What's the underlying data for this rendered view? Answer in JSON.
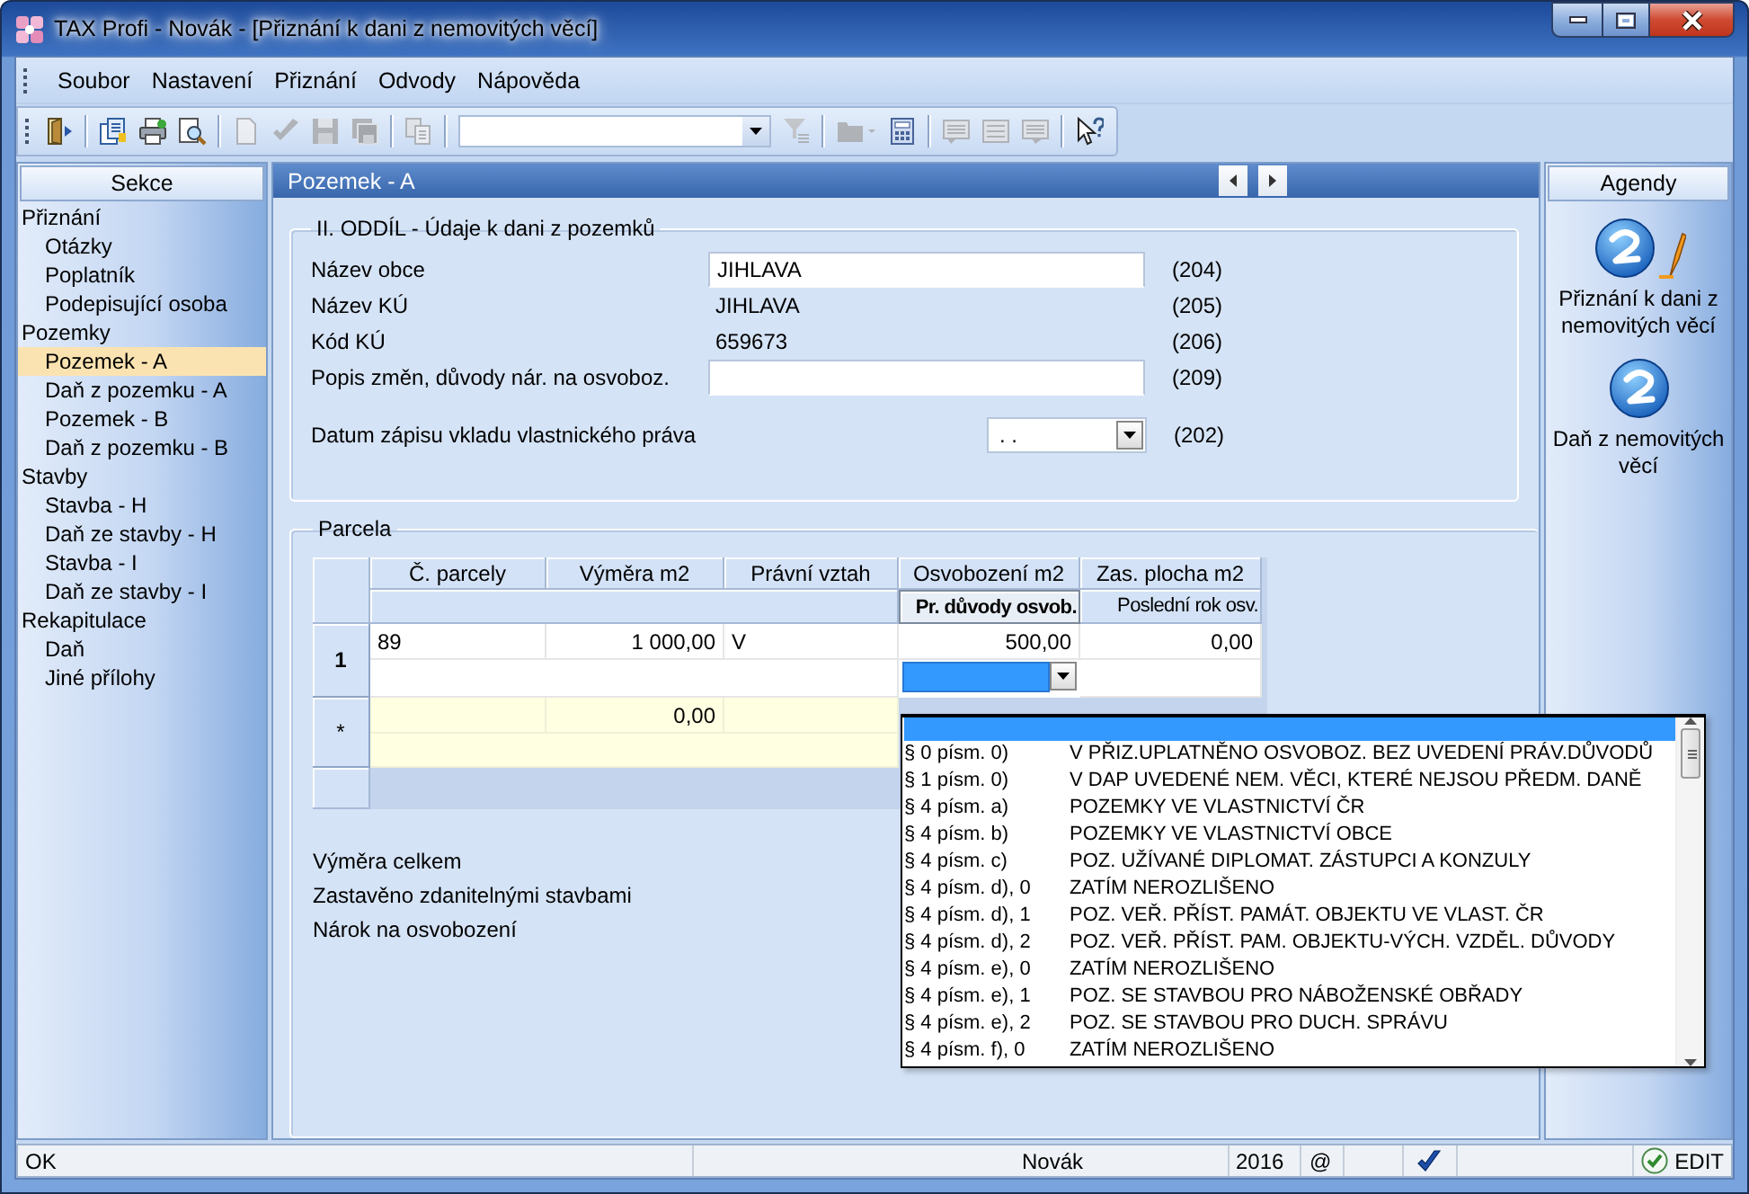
{
  "window": {
    "title": "TAX Profi - Novák - [Přiznání k dani z nemovitých věcí]"
  },
  "menu": [
    {
      "label": "Soubor"
    },
    {
      "label": "Nastavení"
    },
    {
      "label": "Přiznání"
    },
    {
      "label": "Odvody"
    },
    {
      "label": "Nápověda"
    }
  ],
  "toolbar": [
    {
      "kind": "exit",
      "disabled": false
    },
    {
      "kind": "separator"
    },
    {
      "kind": "forms",
      "disabled": false
    },
    {
      "kind": "print",
      "disabled": false
    },
    {
      "kind": "preview",
      "disabled": false
    },
    {
      "kind": "separator"
    },
    {
      "kind": "new",
      "disabled": true
    },
    {
      "kind": "check",
      "disabled": true
    },
    {
      "kind": "save",
      "disabled": true
    },
    {
      "kind": "save_all",
      "disabled": true
    },
    {
      "kind": "separator"
    },
    {
      "kind": "copy",
      "disabled": true
    },
    {
      "kind": "separator"
    },
    {
      "kind": "combo",
      "disabled": false
    },
    {
      "kind": "filter",
      "disabled": true
    },
    {
      "kind": "separator"
    },
    {
      "kind": "folder",
      "disabled": true
    },
    {
      "kind": "calc",
      "disabled": false
    },
    {
      "kind": "separator"
    },
    {
      "kind": "msg_down",
      "disabled": true
    },
    {
      "kind": "msg",
      "disabled": true
    },
    {
      "kind": "msg_up",
      "disabled": true
    },
    {
      "kind": "separator"
    },
    {
      "kind": "help",
      "disabled": false
    }
  ],
  "sidebar": {
    "title": "Sekce",
    "items": [
      {
        "label": "Přiznání",
        "selected": false,
        "children": [
          {
            "label": "Otázky",
            "selected": false
          },
          {
            "label": "Poplatník",
            "selected": false
          },
          {
            "label": "Podepisující osoba",
            "selected": false
          }
        ]
      },
      {
        "label": "Pozemky",
        "selected": false,
        "children": [
          {
            "label": "Pozemek - A",
            "selected": true
          },
          {
            "label": "Daň z pozemku - A",
            "selected": false
          },
          {
            "label": "Pozemek - B",
            "selected": false
          },
          {
            "label": "Daň z pozemku - B",
            "selected": false
          }
        ]
      },
      {
        "label": "Stavby",
        "selected": false,
        "children": [
          {
            "label": "Stavba - H",
            "selected": false
          },
          {
            "label": "Daň ze stavby - H",
            "selected": false
          },
          {
            "label": "Stavba - I",
            "selected": false
          },
          {
            "label": "Daň ze stavby - I",
            "selected": false
          }
        ]
      },
      {
        "label": "Rekapitulace",
        "selected": false,
        "children": [
          {
            "label": "Daň",
            "selected": false
          },
          {
            "label": "Jiné přílohy",
            "selected": false
          }
        ]
      }
    ]
  },
  "panel": {
    "title": "Pozemek - A",
    "section": {
      "title": "II. ODDÍL - Údaje k dani z pozemků",
      "fields": [
        {
          "label": "Název obce",
          "value": "JIHLAVA",
          "code": "(204)",
          "kind": "input"
        },
        {
          "label": "Název KÚ",
          "value": "JIHLAVA",
          "code": "(205)",
          "kind": "text"
        },
        {
          "label": "Kód KÚ",
          "value": "659673",
          "code": "(206)",
          "kind": "text"
        },
        {
          "label": "Popis změn, důvody nár. na osvoboz.",
          "code": "(209)",
          "kind": "input"
        }
      ],
      "date": {
        "label": "Datum zápisu vkladu vlastnického práva",
        "value": ". .",
        "code": "(202)"
      }
    },
    "parcels": {
      "title": "Parcela",
      "columns": [
        "Č. parcely",
        "Výměra m2",
        "Právní vztah",
        "Osvobození m2",
        "Zas. plocha m2"
      ],
      "subcolumns": [
        {
          "label": "Pr. důvody osvob.",
          "selected": true
        },
        {
          "label": "Poslední rok osv.",
          "selected": false
        }
      ],
      "rows": [
        {
          "header": "1",
          "cells": [
            "89",
            "1 000,00",
            "V",
            "500,00",
            "0,00"
          ]
        }
      ],
      "new_row": {
        "header": "*",
        "cells": [
          null,
          "0,00",
          null
        ]
      },
      "dropdown": {
        "options": [
          {
            "selected": true
          },
          {
            "code": "§ 0 písm. 0)",
            "text": "V PŘIZ.UPLATNĚNO OSVOBOZ. BEZ UVEDENÍ PRÁV.DŮVODŮ",
            "selected": false
          },
          {
            "code": "§ 1 písm. 0)",
            "text": "V DAP UVEDENÉ NEM. VĚCI, KTERÉ NEJSOU PŘEDM. DANĚ",
            "selected": false
          },
          {
            "code": "§ 4 písm. a)",
            "text": "POZEMKY VE VLASTNICTVÍ ČR",
            "selected": false
          },
          {
            "code": "§ 4 písm. b)",
            "text": "POZEMKY VE VLASTNICTVÍ OBCE",
            "selected": false
          },
          {
            "code": "§ 4 písm. c)",
            "text": "POZ. UŽÍVANÉ DIPLOMAT. ZÁSTUPCI A KONZULY",
            "selected": false
          },
          {
            "code": "§ 4 písm. d), 0",
            "text": "ZATÍM NEROZLIŠENO",
            "selected": false
          },
          {
            "code": "§ 4 písm. d), 1",
            "text": "POZ. VEŘ. PŘÍST. PAMÁT. OBJEKTU VE VLAST. ČR",
            "selected": false
          },
          {
            "code": "§ 4 písm. d), 2",
            "text": "POZ. VEŘ. PŘÍST. PAM. OBJEKTU-VÝCH. VZDĚL. DŮVODY",
            "selected": false
          },
          {
            "code": "§ 4 písm. e), 0",
            "text": "ZATÍM NEROZLIŠENO",
            "selected": false
          },
          {
            "code": "§ 4 písm. e), 1",
            "text": "POZ. SE STAVBOU PRO NÁBOŽENSKÉ OBŘADY",
            "selected": false
          },
          {
            "code": "§ 4 písm. e), 2",
            "text": "POZ. SE STAVBOU PRO DUCH. SPRÁVU",
            "selected": false
          },
          {
            "code": "§ 4 písm. f), 0",
            "text": "ZATÍM NEROZLIŠENO",
            "selected": false
          }
        ]
      }
    },
    "totals": [
      "Výměra celkem",
      "Zastavěno zdanitelnými stavbami",
      "Nárok na osvobození"
    ]
  },
  "agendas": {
    "title": "Agendy",
    "items": [
      {
        "label": "Přiznání k dani z nemovitých věcí",
        "kind": "edit"
      },
      {
        "label": "Daň z nemovitých věcí",
        "kind": "plain"
      }
    ]
  },
  "status_bar": {
    "message": "OK",
    "user": "Novák",
    "year": "2016",
    "symbol": "@",
    "mode": "EDIT"
  }
}
